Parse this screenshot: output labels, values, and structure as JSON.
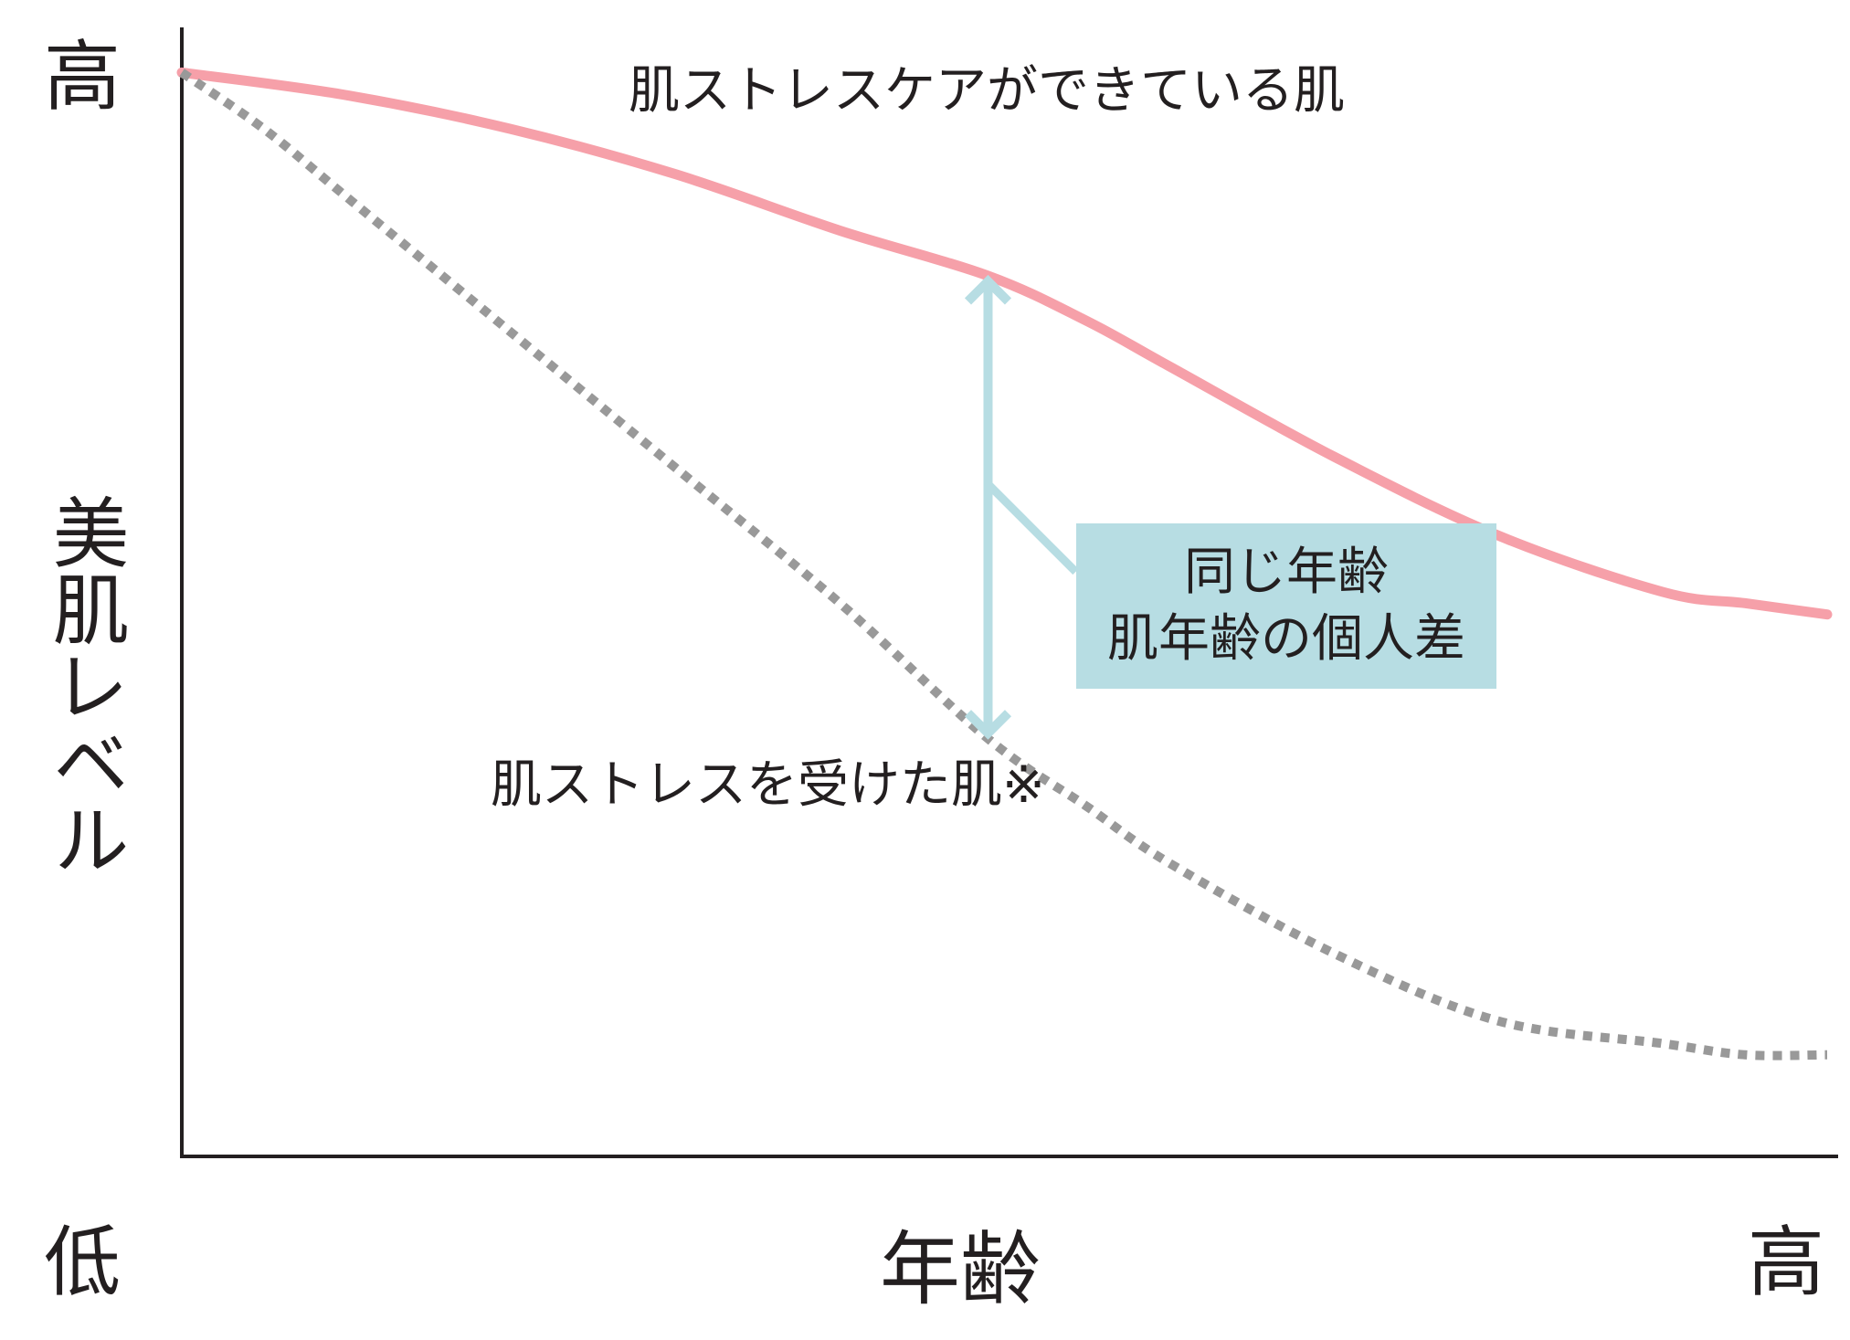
{
  "chart_data": {
    "type": "line",
    "title": "",
    "xlabel": "年齢",
    "ylabel": "美肌レベル",
    "x_tick_labels": [
      "低",
      "高"
    ],
    "y_tick_labels": {
      "high": "高",
      "low": "低"
    },
    "xlim": [
      0,
      1
    ],
    "ylim": [
      0,
      1
    ],
    "grid": false,
    "series": [
      {
        "name": "肌ストレスケアができている肌",
        "style": "solid",
        "color": "#f6a0a9",
        "x": [
          0,
          0.1,
          0.2,
          0.3,
          0.4,
          0.49,
          0.55,
          0.6,
          0.7,
          0.8,
          0.9,
          0.95,
          1.0
        ],
        "y": [
          0.96,
          0.94,
          0.91,
          0.87,
          0.82,
          0.78,
          0.74,
          0.7,
          0.62,
          0.55,
          0.5,
          0.49,
          0.48
        ]
      },
      {
        "name": "肌ストレスを受けた肌※",
        "style": "dotted",
        "color": "#999999",
        "x": [
          0,
          0.05,
          0.1,
          0.2,
          0.3,
          0.4,
          0.49,
          0.55,
          0.6,
          0.7,
          0.8,
          0.9,
          0.95,
          1.0
        ],
        "y": [
          0.96,
          0.91,
          0.85,
          0.73,
          0.61,
          0.49,
          0.37,
          0.31,
          0.26,
          0.18,
          0.12,
          0.1,
          0.09,
          0.09
        ]
      }
    ],
    "annotations": [
      {
        "type": "double-arrow",
        "x": 0.49,
        "from_y": 0.37,
        "to_y": 0.78,
        "color": "#b7dde3",
        "callout_lines": [
          "同じ年齢",
          "肌年齢の個人差"
        ]
      }
    ]
  },
  "labels": {
    "y_high": "高",
    "x_low": "低",
    "x_high": "高",
    "y_title": "美肌レベル",
    "x_title": "年齢",
    "series_top": "肌ストレスケアができている肌",
    "series_bottom": "肌ストレスを受けた肌※",
    "callout_line1": "同じ年齢",
    "callout_line2": "肌年齢の個人差"
  },
  "colors": {
    "axis": "#231f20",
    "good_skin_line": "#f6a0a9",
    "stressed_skin_line": "#999999",
    "callout_bg": "#b7dde3",
    "arrow": "#b7dde3"
  }
}
